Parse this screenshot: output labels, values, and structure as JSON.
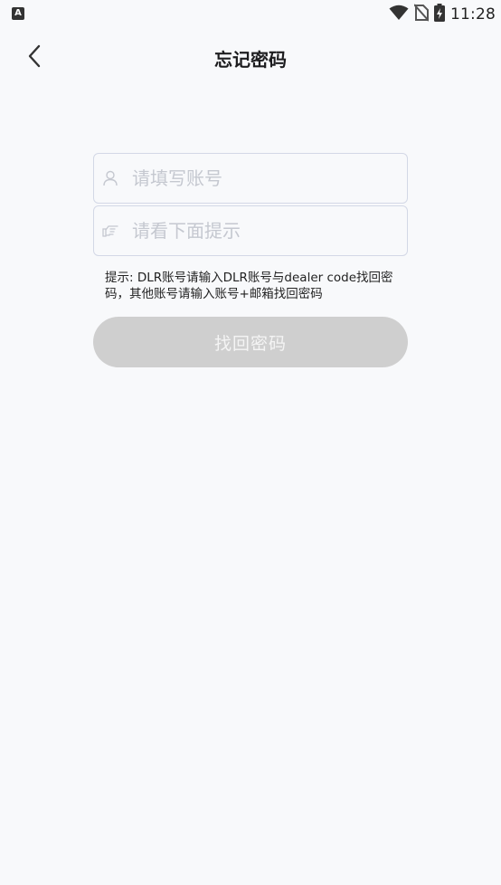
{
  "status_bar": {
    "app_badge": "A",
    "time": "11:28",
    "icons": [
      "wifi-icon",
      "no-sim-icon",
      "battery-charging-icon"
    ]
  },
  "header": {
    "title": "忘记密码",
    "back_icon": "chevron-left-icon"
  },
  "form": {
    "account_field": {
      "placeholder": "请填写账号",
      "value": "",
      "icon": "user-icon"
    },
    "hint_field": {
      "placeholder": "请看下面提示",
      "value": "",
      "icon": "pointing-hand-icon"
    },
    "tip": "提示: DLR账号请输入DLR账号与dealer code找回密码，其他账号请输入账号+邮箱找回密码",
    "submit_label": "找回密码"
  },
  "colors": {
    "background": "#f8f9fb",
    "field_border": "#d3d8e6",
    "button_disabled": "#cfcfcf",
    "placeholder": "#c5c8d0"
  }
}
